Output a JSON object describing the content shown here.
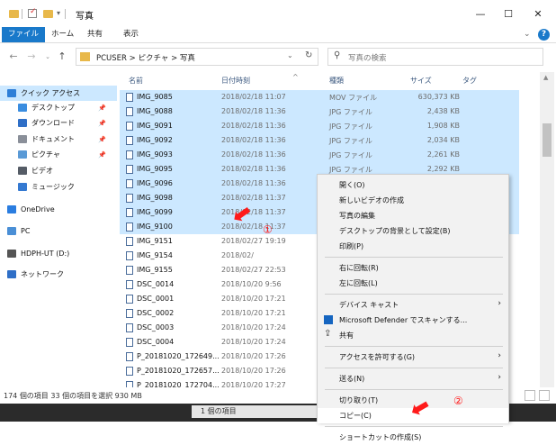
{
  "window": {
    "title": "写真",
    "minimize": "—",
    "maximize": "☐",
    "close": "✕"
  },
  "ribbon": {
    "tabs": [
      "ファイル",
      "ホーム",
      "共有",
      "表示"
    ],
    "collapse": "⌄",
    "help": "?"
  },
  "address": {
    "path": "PCUSER > ピクチャ > 写真",
    "search_placeholder": "写真の検索"
  },
  "sidebar": {
    "items": [
      {
        "label": "クイック アクセス",
        "color": "#2f7fd7"
      },
      {
        "label": "デスクトップ",
        "color": "#3a8de0",
        "pin": "📌"
      },
      {
        "label": "ダウンロード",
        "color": "#2f6fc7",
        "pin": "📌"
      },
      {
        "label": "ドキュメント",
        "color": "#8a8f99",
        "pin": "📌"
      },
      {
        "label": "ピクチャ",
        "color": "#5a9ad6",
        "pin": "📌"
      },
      {
        "label": "ビデオ",
        "color": "#555c66"
      },
      {
        "label": "ミュージック",
        "color": "#3479d1"
      },
      {
        "label": "OneDrive",
        "color": "#2a7de0"
      },
      {
        "label": "PC",
        "color": "#4a8fd6"
      },
      {
        "label": "HDPH-UT (D:)",
        "color": "#555"
      },
      {
        "label": "ネットワーク",
        "color": "#2f6fc7"
      }
    ]
  },
  "columns": {
    "name": "名前",
    "date": "日付時刻",
    "type": "種類",
    "size": "サイズ",
    "tag": "タグ",
    "sort_arrow": "^"
  },
  "files": [
    {
      "name": "IMG_9085",
      "date": "2018/02/18 11:07",
      "type": "MOV ファイル",
      "size": "630,373 KB",
      "sel": true
    },
    {
      "name": "IMG_9088",
      "date": "2018/02/18 11:36",
      "type": "JPG ファイル",
      "size": "2,438 KB",
      "sel": true
    },
    {
      "name": "IMG_9091",
      "date": "2018/02/18 11:36",
      "type": "JPG ファイル",
      "size": "1,908 KB",
      "sel": true
    },
    {
      "name": "IMG_9092",
      "date": "2018/02/18 11:36",
      "type": "JPG ファイル",
      "size": "2,034 KB",
      "sel": true
    },
    {
      "name": "IMG_9093",
      "date": "2018/02/18 11:36",
      "type": "JPG ファイル",
      "size": "2,261 KB",
      "sel": true
    },
    {
      "name": "IMG_9095",
      "date": "2018/02/18 11:36",
      "type": "JPG ファイル",
      "size": "2,292 KB",
      "sel": true
    },
    {
      "name": "IMG_9096",
      "date": "2018/02/18 11:36",
      "type": "",
      "size": "",
      "sel": true
    },
    {
      "name": "IMG_9098",
      "date": "2018/02/18 11:37",
      "type": "",
      "size": "",
      "sel": true
    },
    {
      "name": "IMG_9099",
      "date": "2018/02/18 11:37",
      "type": "",
      "size": "",
      "sel": true
    },
    {
      "name": "IMG_9100",
      "date": "2018/02/18 11:37",
      "type": "",
      "size": "",
      "sel": true
    },
    {
      "name": "IMG_9151",
      "date": "2018/02/27 19:19",
      "type": "",
      "size": "",
      "sel": false
    },
    {
      "name": "IMG_9154",
      "date": "2018/02/",
      "type": "",
      "size": "",
      "sel": false
    },
    {
      "name": "IMG_9155",
      "date": "2018/02/27 22:53",
      "type": "",
      "size": "",
      "sel": false
    },
    {
      "name": "DSC_0014",
      "date": "2018/10/20 9:56",
      "type": "",
      "size": "",
      "sel": false
    },
    {
      "name": "DSC_0001",
      "date": "2018/10/20 17:21",
      "type": "",
      "size": "",
      "sel": false
    },
    {
      "name": "DSC_0002",
      "date": "2018/10/20 17:21",
      "type": "",
      "size": "",
      "sel": false
    },
    {
      "name": "DSC_0003",
      "date": "2018/10/20 17:24",
      "type": "",
      "size": "",
      "sel": false
    },
    {
      "name": "DSC_0004",
      "date": "2018/10/20 17:24",
      "type": "",
      "size": "",
      "sel": false
    },
    {
      "name": "P_20181020_172649...",
      "date": "2018/10/20 17:26",
      "type": "",
      "size": "",
      "sel": false
    },
    {
      "name": "P_20181020_172657...",
      "date": "2018/10/20 17:26",
      "type": "",
      "size": "",
      "sel": false
    },
    {
      "name": "P_20181020_172704...",
      "date": "2018/10/20 17:27",
      "type": "",
      "size": "",
      "sel": false
    }
  ],
  "context_menu": {
    "items": [
      {
        "label": "開く(O)"
      },
      {
        "label": "新しいビデオの作成"
      },
      {
        "label": "写真の編集"
      },
      {
        "label": "デスクトップの背景として設定(B)"
      },
      {
        "label": "印刷(P)"
      },
      {
        "sep": true
      },
      {
        "label": "右に回転(R)"
      },
      {
        "label": "左に回転(L)"
      },
      {
        "sep": true
      },
      {
        "label": "デバイス キャスト",
        "arrow": "›"
      },
      {
        "label": "Microsoft Defender でスキャンする...",
        "icon": "shield"
      },
      {
        "label": "共有",
        "icon": "share"
      },
      {
        "sep": true
      },
      {
        "label": "アクセスを許可する(G)",
        "arrow": "›"
      },
      {
        "sep": true
      },
      {
        "label": "送る(N)",
        "arrow": "›"
      },
      {
        "sep": true
      },
      {
        "label": "切り取り(T)"
      },
      {
        "label": "コピー(C)",
        "id": "copy"
      },
      {
        "sep": true
      },
      {
        "label": "ショートカットの作成(S)"
      }
    ]
  },
  "annotations": {
    "one": "①",
    "two": "②"
  },
  "status": {
    "text": "174 個の項目 33 個の項目を選択 930 MB",
    "bottom_label": "1 個の項目"
  }
}
